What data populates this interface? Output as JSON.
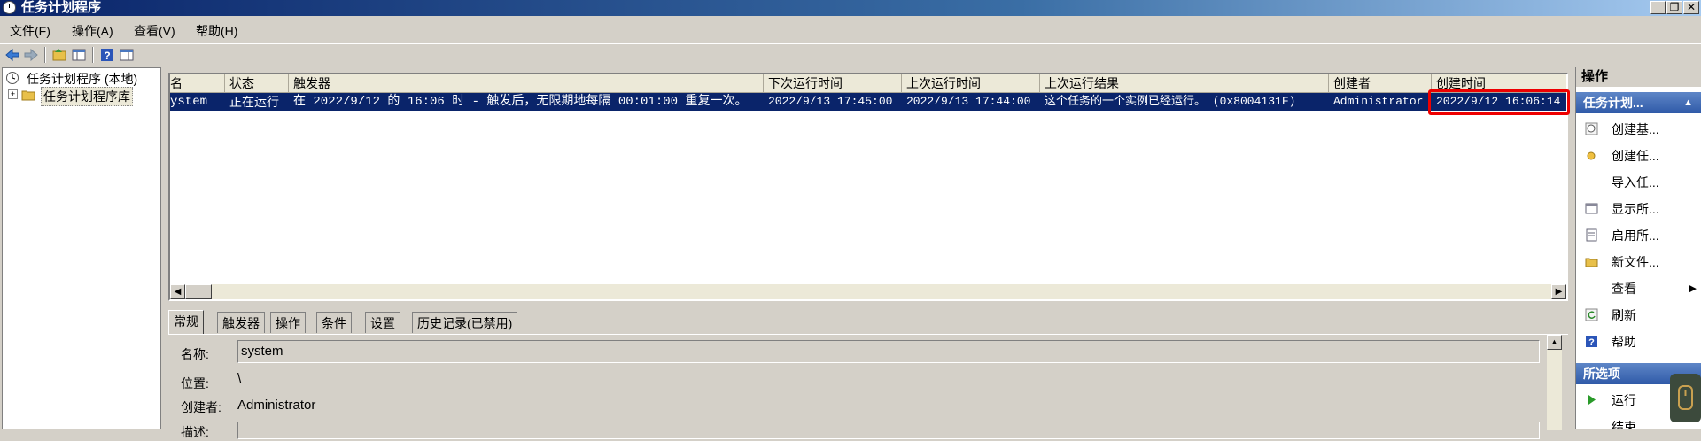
{
  "window": {
    "title": "任务计划程序",
    "minimize": "_",
    "maximize": "❐",
    "close": "✕"
  },
  "menu": [
    "文件(F)",
    "操作(A)",
    "查看(V)",
    "帮助(H)"
  ],
  "tree": {
    "root": "任务计划程序 (本地)",
    "child": "任务计划程序库",
    "expander": "+"
  },
  "table": {
    "columns": [
      "名",
      "状态",
      "触发器",
      "下次运行时间",
      "上次运行时间",
      "上次运行结果",
      "创建者",
      "创建时间"
    ],
    "row": {
      "name": "ystem",
      "status": "正在运行",
      "trigger": "在 2022/9/12 的 16:06 时 - 触发后，无限期地每隔 00:01:00 重复一次。",
      "next_run": "2022/9/13 17:45:00",
      "last_run": "2022/9/13 17:44:00",
      "last_result": "这个任务的一个实例已经运行。 (0x8004131F)",
      "author": "Administrator",
      "created": "2022/9/12 16:06:14"
    }
  },
  "tabs": [
    "常规",
    "触发器",
    "操作",
    "条件",
    "设置",
    "历史记录(已禁用)"
  ],
  "detail": {
    "name_label": "名称:",
    "name_value": "system",
    "location_label": "位置:",
    "location_value": "\\",
    "author_label": "创建者:",
    "author_value": "Administrator",
    "desc_label": "描述:"
  },
  "actions": {
    "title": "操作",
    "section1": "任务计划...",
    "section1_arrow": "▲",
    "items": [
      "创建基...",
      "创建任...",
      "导入任...",
      "显示所...",
      "启用所...",
      "新文件...",
      "查看",
      "刷新",
      "帮助"
    ],
    "view_arrow": "▶",
    "section2": "所选项",
    "selected_items": [
      "运行",
      "结束"
    ]
  },
  "colors": {
    "selection": "#0a246a",
    "highlight_box": "#e00000",
    "section_blue": "#2f5aa8"
  }
}
